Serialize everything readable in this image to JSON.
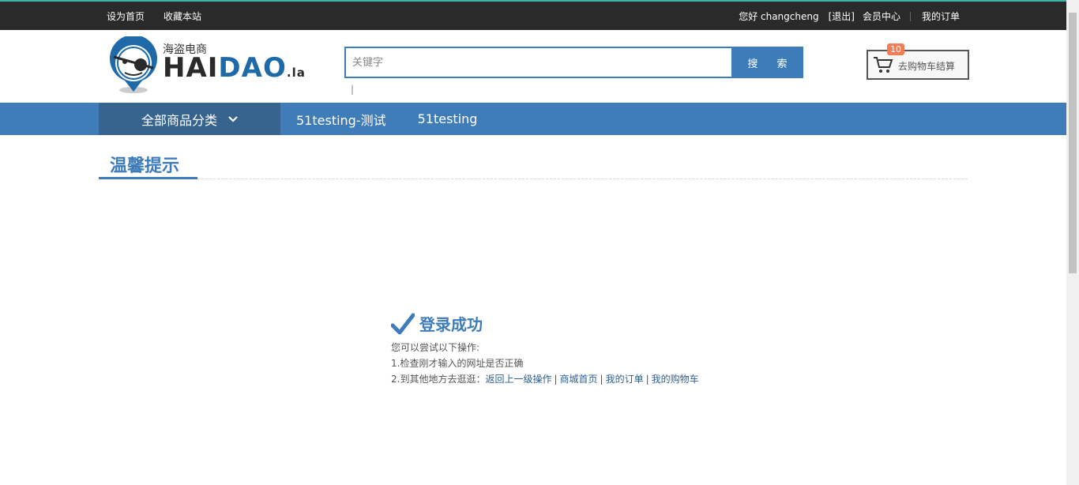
{
  "topbar": {
    "left": [
      "设为首页",
      "收藏本站"
    ],
    "greeting": "您好 changcheng",
    "logout": "[退出]",
    "member_center": "会员中心",
    "my_orders": "我的订单"
  },
  "logo": {
    "cn": "海盗电商",
    "en_a": "HAI",
    "en_b": "DAO",
    "en_c": ".la"
  },
  "search": {
    "placeholder": "关键字",
    "button": "搜 索",
    "hotwords": "|"
  },
  "cart": {
    "label": "去购物车结算",
    "count": "10",
    "icon": "shopping-cart-icon"
  },
  "nav": {
    "all_categories": "全部商品分类",
    "links": [
      "51testing-测试",
      "51testing"
    ]
  },
  "page": {
    "title": "温馨提示"
  },
  "message": {
    "headline": "登录成功",
    "line1": "您可以尝试以下操作:",
    "line2": "1.检查刚才输入的网址是否正确",
    "line3_prefix": "2.到其他地方去逛逛：",
    "links": [
      "返回上一级操作",
      "商城首页",
      "我的订单",
      "我的购物车"
    ]
  },
  "colors": {
    "accent": "#3d7cb9",
    "topbar": "#2a2a2a",
    "badge": "#ef7d57"
  }
}
